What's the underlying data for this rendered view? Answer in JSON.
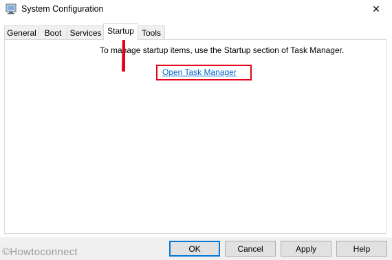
{
  "window": {
    "title": "System Configuration",
    "close_glyph": "✕"
  },
  "tabs": [
    {
      "label": "General",
      "active": false
    },
    {
      "label": "Boot",
      "active": false
    },
    {
      "label": "Services",
      "active": false
    },
    {
      "label": "Startup",
      "active": true
    },
    {
      "label": "Tools",
      "active": false
    }
  ],
  "startup": {
    "message": "To manage startup items, use the Startup section of Task Manager.",
    "link_label": "Open Task Manager"
  },
  "buttons": {
    "ok": "OK",
    "cancel": "Cancel",
    "apply": "Apply",
    "help": "Help"
  },
  "watermark": "©Howtoconnect",
  "colors": {
    "annotation_red": "#e3001b",
    "link_blue": "#0066cc",
    "default_button_border": "#0078d7"
  }
}
